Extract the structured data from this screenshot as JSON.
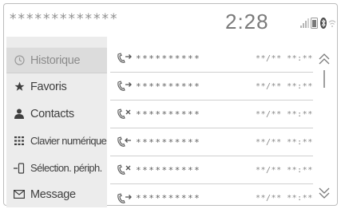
{
  "status_bar": {
    "device_name": "*************",
    "time": "2:28",
    "icons": [
      "signal-bars-icon",
      "phone-battery-icon",
      "bluetooth-icon",
      "wifi-icon"
    ]
  },
  "sidebar": {
    "items": [
      {
        "label": "Historique",
        "icon": "clock-icon",
        "selected": true
      },
      {
        "label": "Favoris",
        "icon": "star-icon",
        "selected": false
      },
      {
        "label": "Contacts",
        "icon": "person-icon",
        "selected": false
      },
      {
        "label": "Clavier numérique",
        "icon": "keypad-icon",
        "selected": false
      },
      {
        "label": "Sélection. périph.",
        "icon": "device-select-icon",
        "selected": false
      },
      {
        "label": "Message",
        "icon": "envelope-icon",
        "selected": false
      }
    ]
  },
  "call_history": {
    "rows": [
      {
        "type": "outgoing",
        "icon": "outgoing-call-icon",
        "number": "**********",
        "datetime": "**/** **:**"
      },
      {
        "type": "outgoing",
        "icon": "outgoing-call-icon",
        "number": "**********",
        "datetime": "**/** **:**"
      },
      {
        "type": "missed",
        "icon": "missed-call-icon",
        "number": "**********",
        "datetime": "**/** **:**"
      },
      {
        "type": "incoming",
        "icon": "incoming-call-icon",
        "number": "**********",
        "datetime": "**/** **:**"
      },
      {
        "type": "missed",
        "icon": "missed-call-icon",
        "number": "**********",
        "datetime": "**/** **:**"
      },
      {
        "type": "outgoing",
        "icon": "outgoing-call-icon",
        "number": "**********",
        "datetime": "**/** **:**"
      }
    ]
  },
  "scroll": {
    "up_icon": "chevron-double-up-icon",
    "down_icon": "chevron-double-down-icon"
  },
  "colors": {
    "sidebar_bg": "#ececec",
    "selected_bg": "#dcdcdc",
    "divider": "#cfcfcf"
  }
}
